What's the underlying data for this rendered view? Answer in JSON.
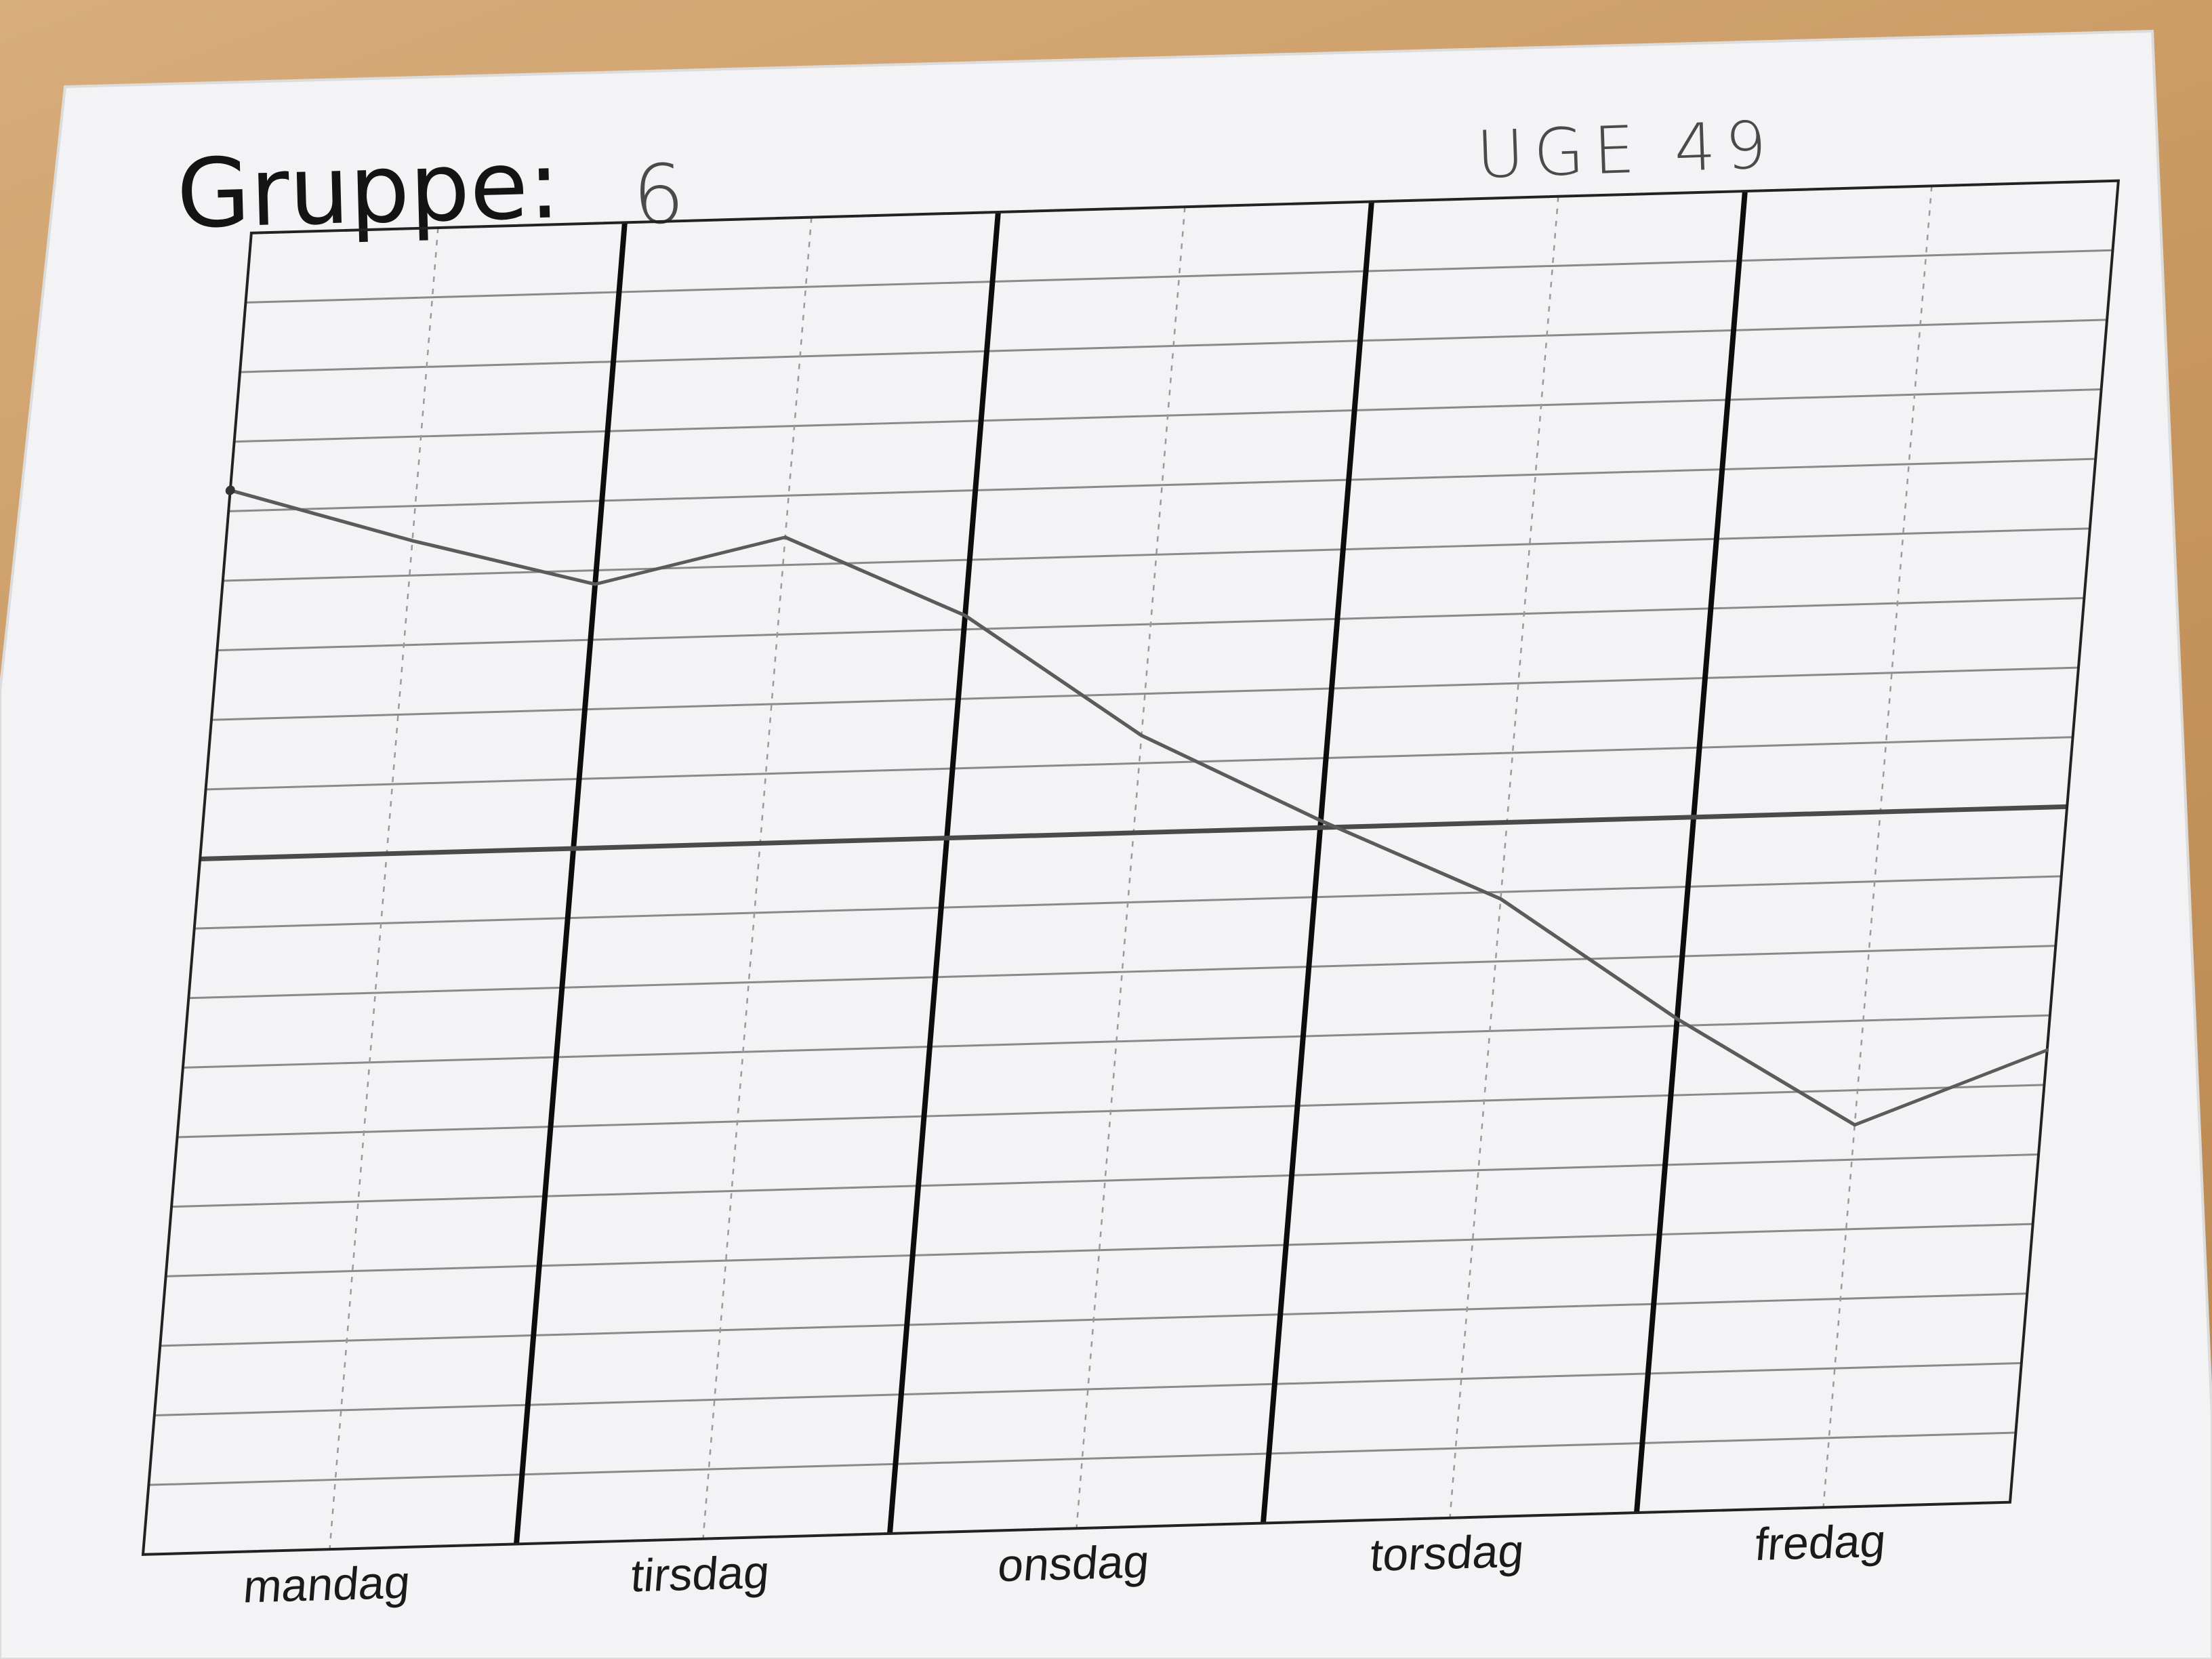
{
  "sheet": {
    "title_label": "Gruppe:",
    "group_number": "6",
    "week_label": "UGE 49"
  },
  "colors": {
    "paper": "#f4f4f6",
    "table": "#c8975f",
    "grid": "#8a8a8a",
    "day_divider": "#0d0d0d",
    "line": "#5b5b5b"
  },
  "chart_data": {
    "type": "line",
    "title": "",
    "xlabel": "",
    "ylabel": "",
    "categories": [
      "mandag",
      "tirsdag",
      "onsdag",
      "torsdag",
      "fredag"
    ],
    "x_range": [
      0,
      5
    ],
    "ylim": [
      -10,
      9
    ],
    "grid": true,
    "minor_x_per_day": 2,
    "series": [
      {
        "values_xy": [
          [
            0.0,
            5.3
          ],
          [
            0.5,
            4.5
          ],
          [
            1.0,
            3.8
          ],
          [
            1.5,
            4.4
          ],
          [
            2.0,
            3.2
          ],
          [
            2.5,
            1.4
          ],
          [
            3.0,
            0.1
          ],
          [
            3.5,
            -1.1
          ],
          [
            4.0,
            -2.9
          ],
          [
            4.5,
            -4.5
          ],
          [
            5.0,
            -3.5
          ]
        ]
      }
    ]
  }
}
